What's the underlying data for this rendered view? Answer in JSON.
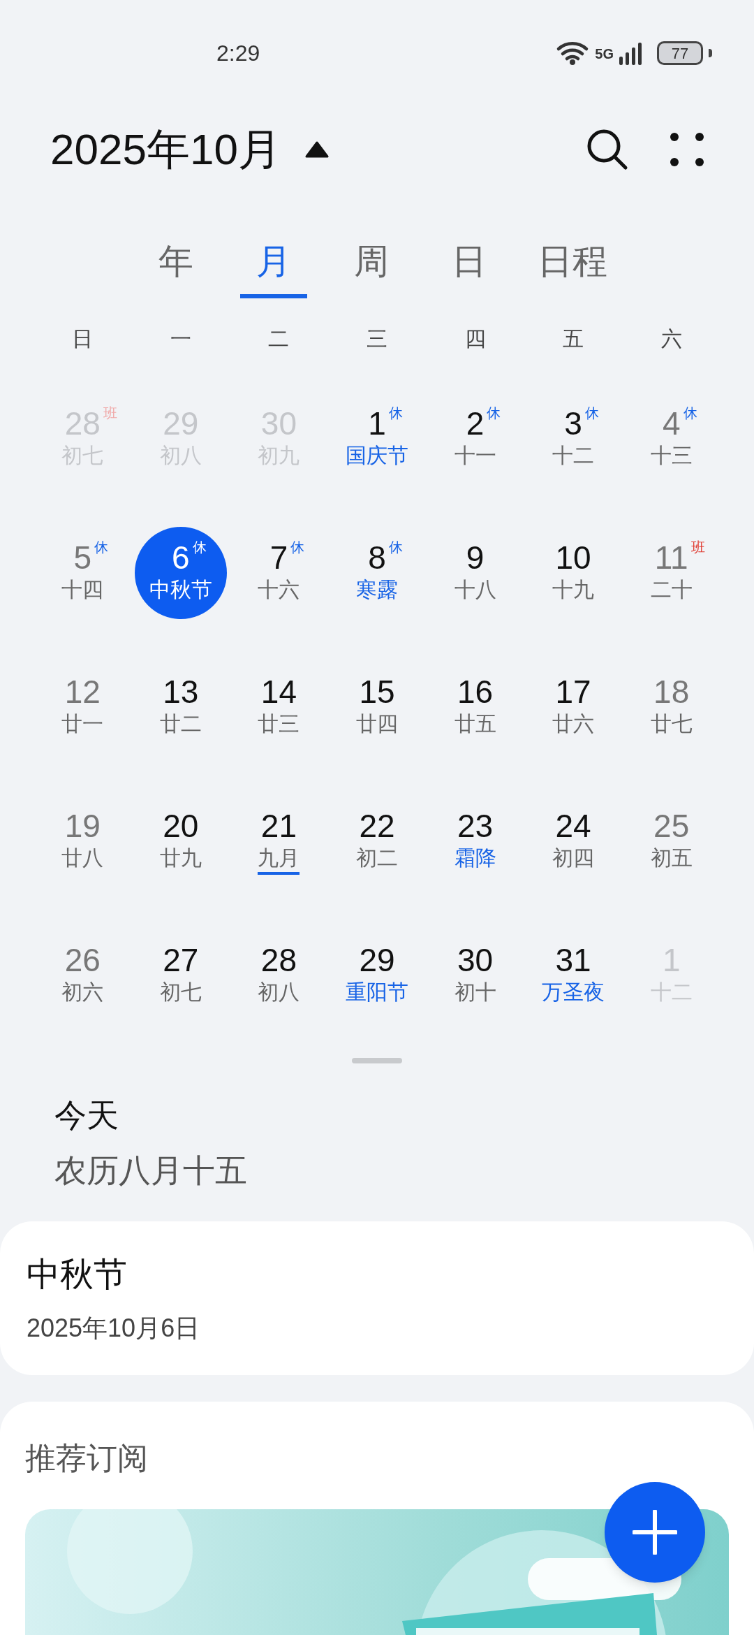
{
  "status_bar": {
    "time": "2:29",
    "network": "5G",
    "battery": "77"
  },
  "header": {
    "title": "2025年10月"
  },
  "tabs": [
    {
      "label": "年",
      "selected": false
    },
    {
      "label": "月",
      "selected": true
    },
    {
      "label": "周",
      "selected": false
    },
    {
      "label": "日",
      "selected": false
    },
    {
      "label": "日程",
      "selected": false
    }
  ],
  "weekdays": [
    "日",
    "一",
    "二",
    "三",
    "四",
    "五",
    "六"
  ],
  "days": [
    {
      "day": "28",
      "lunar": "初七",
      "badge": {
        "text": "班",
        "kind": "work"
      },
      "outside": true,
      "festival": false,
      "selected": false,
      "underlined": false
    },
    {
      "day": "29",
      "lunar": "初八",
      "outside": true,
      "festival": false,
      "selected": false,
      "underlined": false
    },
    {
      "day": "30",
      "lunar": "初九",
      "outside": true,
      "festival": false,
      "selected": false,
      "underlined": false
    },
    {
      "day": "1",
      "lunar": "国庆节",
      "badge": {
        "text": "休",
        "kind": "rest"
      },
      "outside": false,
      "festival": true,
      "selected": false,
      "underlined": false
    },
    {
      "day": "2",
      "lunar": "十一",
      "badge": {
        "text": "休",
        "kind": "rest"
      },
      "outside": false,
      "festival": false,
      "selected": false,
      "underlined": false
    },
    {
      "day": "3",
      "lunar": "十二",
      "badge": {
        "text": "休",
        "kind": "rest"
      },
      "outside": false,
      "festival": false,
      "selected": false,
      "underlined": false
    },
    {
      "day": "4",
      "lunar": "十三",
      "badge": {
        "text": "休",
        "kind": "rest"
      },
      "outside": false,
      "festival": false,
      "selected": false,
      "underlined": false
    },
    {
      "day": "5",
      "lunar": "十四",
      "badge": {
        "text": "休",
        "kind": "rest"
      },
      "outside": false,
      "festival": false,
      "selected": false,
      "underlined": false
    },
    {
      "day": "6",
      "lunar": "中秋节",
      "badge": {
        "text": "休",
        "kind": "rest"
      },
      "outside": false,
      "festival": true,
      "selected": true,
      "underlined": false
    },
    {
      "day": "7",
      "lunar": "十六",
      "badge": {
        "text": "休",
        "kind": "rest"
      },
      "outside": false,
      "festival": false,
      "selected": false,
      "underlined": false
    },
    {
      "day": "8",
      "lunar": "寒露",
      "badge": {
        "text": "休",
        "kind": "rest"
      },
      "outside": false,
      "festival": true,
      "selected": false,
      "underlined": false
    },
    {
      "day": "9",
      "lunar": "十八",
      "outside": false,
      "festival": false,
      "selected": false,
      "underlined": false
    },
    {
      "day": "10",
      "lunar": "十九",
      "outside": false,
      "festival": false,
      "selected": false,
      "underlined": false
    },
    {
      "day": "11",
      "lunar": "二十",
      "badge": {
        "text": "班",
        "kind": "work"
      },
      "outside": false,
      "festival": false,
      "selected": false,
      "underlined": false
    },
    {
      "day": "12",
      "lunar": "廿一",
      "outside": false,
      "festival": false,
      "selected": false,
      "underlined": false
    },
    {
      "day": "13",
      "lunar": "廿二",
      "outside": false,
      "festival": false,
      "selected": false,
      "underlined": false
    },
    {
      "day": "14",
      "lunar": "廿三",
      "outside": false,
      "festival": false,
      "selected": false,
      "underlined": false
    },
    {
      "day": "15",
      "lunar": "廿四",
      "outside": false,
      "festival": false,
      "selected": false,
      "underlined": false
    },
    {
      "day": "16",
      "lunar": "廿五",
      "outside": false,
      "festival": false,
      "selected": false,
      "underlined": false
    },
    {
      "day": "17",
      "lunar": "廿六",
      "outside": false,
      "festival": false,
      "selected": false,
      "underlined": false
    },
    {
      "day": "18",
      "lunar": "廿七",
      "outside": false,
      "festival": false,
      "selected": false,
      "underlined": false
    },
    {
      "day": "19",
      "lunar": "廿八",
      "outside": false,
      "festival": false,
      "selected": false,
      "underlined": false
    },
    {
      "day": "20",
      "lunar": "廿九",
      "outside": false,
      "festival": false,
      "selected": false,
      "underlined": false
    },
    {
      "day": "21",
      "lunar": "九月",
      "outside": false,
      "festival": false,
      "selected": false,
      "underlined": true
    },
    {
      "day": "22",
      "lunar": "初二",
      "outside": false,
      "festival": false,
      "selected": false,
      "underlined": false
    },
    {
      "day": "23",
      "lunar": "霜降",
      "outside": false,
      "festival": true,
      "selected": false,
      "underlined": false
    },
    {
      "day": "24",
      "lunar": "初四",
      "outside": false,
      "festival": false,
      "selected": false,
      "underlined": false
    },
    {
      "day": "25",
      "lunar": "初五",
      "outside": false,
      "festival": false,
      "selected": false,
      "underlined": false
    },
    {
      "day": "26",
      "lunar": "初六",
      "outside": false,
      "festival": false,
      "selected": false,
      "underlined": false
    },
    {
      "day": "27",
      "lunar": "初七",
      "outside": false,
      "festival": false,
      "selected": false,
      "underlined": false
    },
    {
      "day": "28",
      "lunar": "初八",
      "outside": false,
      "festival": false,
      "selected": false,
      "underlined": false
    },
    {
      "day": "29",
      "lunar": "重阳节",
      "outside": false,
      "festival": true,
      "selected": false,
      "underlined": false
    },
    {
      "day": "30",
      "lunar": "初十",
      "outside": false,
      "festival": false,
      "selected": false,
      "underlined": false
    },
    {
      "day": "31",
      "lunar": "万圣夜",
      "outside": false,
      "festival": true,
      "selected": false,
      "underlined": false
    },
    {
      "day": "1",
      "lunar": "十二",
      "outside": true,
      "festival": false,
      "selected": false,
      "underlined": false
    }
  ],
  "today": {
    "title": "今天",
    "lunar_date": "农历八月十五"
  },
  "event_card": {
    "title": "中秋节",
    "date": "2025年10月6日"
  },
  "subscriptions": {
    "title": "推荐订阅"
  }
}
